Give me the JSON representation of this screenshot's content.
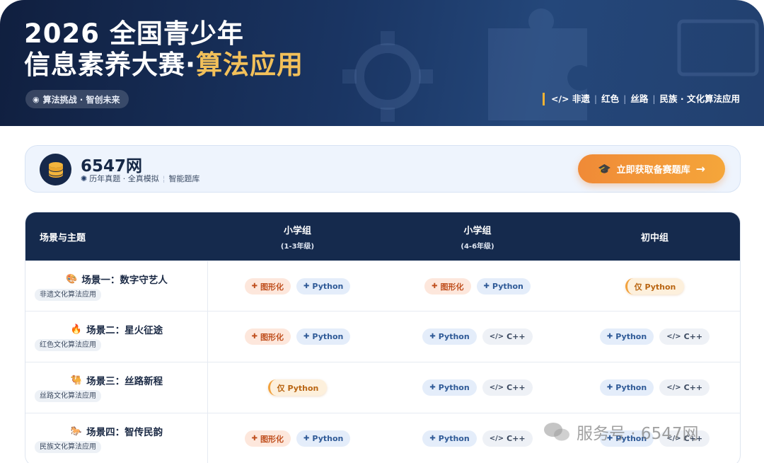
{
  "banner": {
    "title_line1": "2026 全国青少年",
    "title_line2_main": "信息素养大赛",
    "title_line2_dot": "·",
    "title_line2_accent": "算法应用",
    "chip_icon": "◉",
    "chip_text": "算法挑战 · 智创未来",
    "right_items": [
      "</> 非遗",
      "红色",
      "丝路",
      "民族 · 文化算法应用"
    ],
    "separator": "|"
  },
  "brand": {
    "name": "6547网",
    "sub_part1": "历年真题 · 全真模拟",
    "sub_part2": "智能题库",
    "gear_icon": "✺",
    "cta_label": "立即获取备赛题库",
    "cta_icon": "🎓",
    "cta_arrow": "→"
  },
  "table": {
    "headers": {
      "scene": "场景与主题",
      "g1_main": "小学组",
      "g1_sub": "(1-3年级)",
      "g2_main": "小学组",
      "g2_sub": "(4-6年级)",
      "g3_main": "初中组"
    },
    "rows": [
      {
        "emoji": "🎨",
        "title": "场景一：数字守艺人",
        "tag": "非遗文化算法应用"
      },
      {
        "emoji": "🔥",
        "title": "场景二：星火征途",
        "tag": "红色文化算法应用"
      },
      {
        "emoji": "🐫",
        "title": "场景三：丝路新程",
        "tag": "丝路文化算法应用"
      },
      {
        "emoji": "🐎",
        "title": "场景四：智传民韵",
        "tag": "民族文化算法应用"
      }
    ],
    "labels": {
      "graphical": "图形化",
      "python": "Python",
      "cpp": "C++",
      "only_python": "仅 Python",
      "cpp_icon": "</>",
      "puzzle_icon": "✚"
    }
  },
  "watermark": {
    "text": "服务号 · 6547网"
  },
  "colors": {
    "banner_bg": "#1a3563",
    "accent_gold": "#f2c05a",
    "cta_orange": "#f08a37",
    "header_navy": "#152a4d"
  }
}
